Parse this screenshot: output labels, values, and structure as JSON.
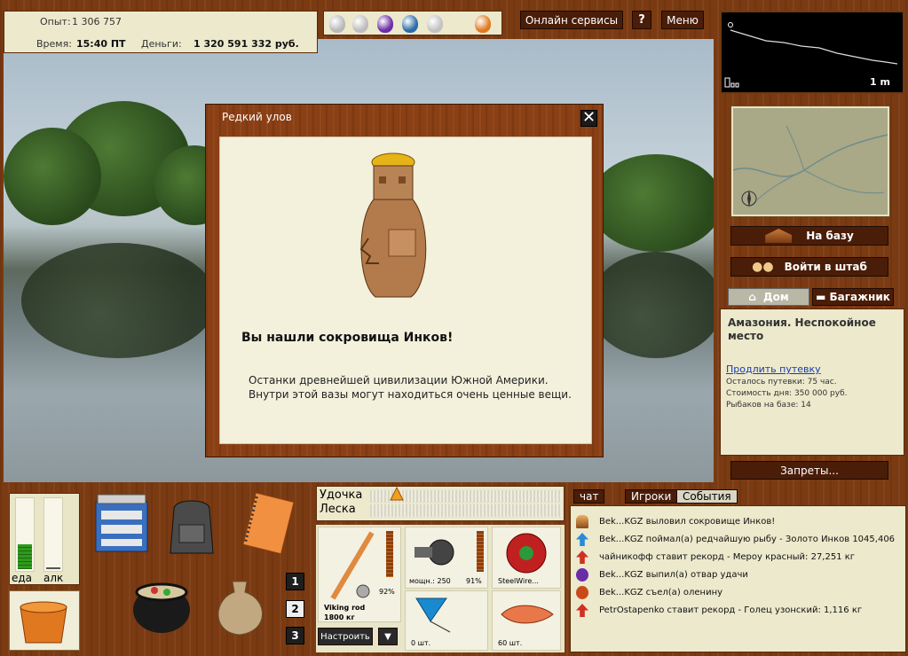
{
  "stats": {
    "exp_label": "Опыт:",
    "exp_value": "1 306 757",
    "time_label": "Время:",
    "time_value": "15:40 ПТ",
    "money_label": "Деньги:",
    "money_value": "1 320 591 332 руб."
  },
  "potions": {
    "colors": [
      "#b9b9b9",
      "#bdbdbd",
      "#6b2ca8",
      "#2b6ca8",
      "#c2c2c2",
      "#e07a20"
    ]
  },
  "header": {
    "online_label": "Онлайн сервисы",
    "help_label": "?",
    "menu_label": "Меню"
  },
  "depth": {
    "value": "1 m"
  },
  "nav": {
    "base_label": "На базу",
    "hq_label": "Войти в штаб"
  },
  "tabs": {
    "home_label": "Дом",
    "trunk_label": "Багажник"
  },
  "location": {
    "title": "Амазония. Неспокойное место",
    "extend_link": "Продлить путевку",
    "line1": "Осталось путевки: 75 час.",
    "line2": "Стоимость дня: 350 000 руб.",
    "line3": "Рыбаков на базе: 14"
  },
  "bans_label": "Запреты...",
  "dialog": {
    "title": "Редкий улов",
    "close": "✕",
    "heading": "Вы нашли сокровища Инков!",
    "text": "Останки древнейшей цивилизации Южной Америки. Внутри этой вазы могут находиться очень ценные вещи."
  },
  "needs": {
    "food_label": "еда",
    "alc_label": "алк",
    "food_level": 0.35,
    "alc_level": 0.02
  },
  "slots": [
    "1",
    "2",
    "3"
  ],
  "tension": {
    "rod_label": "Удочка",
    "line_label": "Леска"
  },
  "gear": {
    "rod_name": "Viking rod",
    "rod_weight": "1800 кг",
    "rod_pct": "92%",
    "reel_power": "мощн.: 250",
    "reel_pct": "91%",
    "line_name": "SteelWire...",
    "float_count": "0 шт.",
    "bait_count": "60 шт.",
    "setup_label": "Настроить",
    "dropdown": "▼"
  },
  "chat": {
    "tabs": [
      "чат",
      "Игроки",
      "События"
    ],
    "events": [
      {
        "icon": "torch",
        "text": "Bek...KGZ выловил сокровище Инков!"
      },
      {
        "icon": "arrow-blue",
        "text": "Bek...KGZ поймал(а) редчайшую рыбу - Золото Инков 1045,406"
      },
      {
        "icon": "arrow-red",
        "text": "чайникофф ставит рекорд - Мероу красный: 27,251 кг"
      },
      {
        "icon": "potion",
        "text": "Bek...KGZ выпил(а) отвар удачи"
      },
      {
        "icon": "food",
        "text": "Bek...KGZ съел(а) оленину"
      },
      {
        "icon": "arrow-red",
        "text": "PetrOstapenko ставит рекорд - Голец узонский: 1,116 кг"
      }
    ]
  }
}
